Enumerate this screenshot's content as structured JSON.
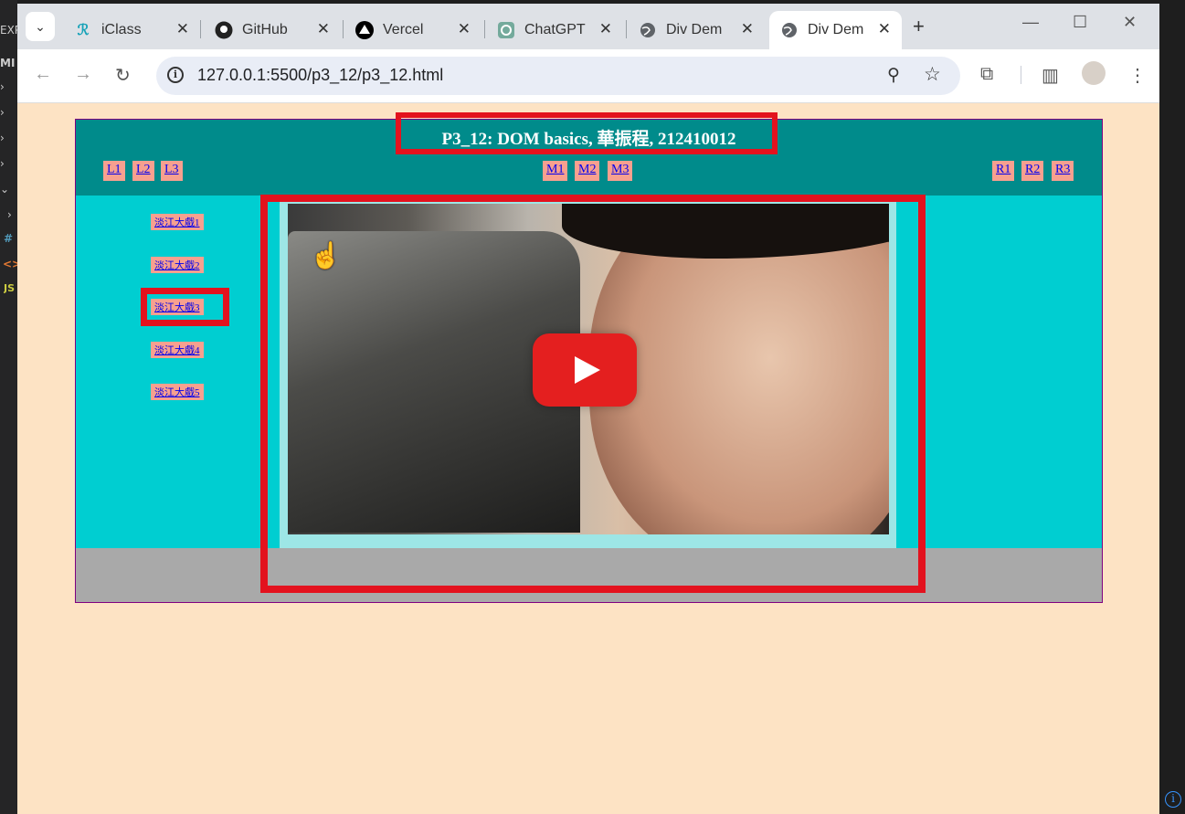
{
  "editor_strip": {
    "labels": [
      "EXP",
      "MI",
      "#",
      "<>",
      "JS"
    ]
  },
  "browser": {
    "tabs": [
      {
        "title": "iClass",
        "icon": "iclass-icon"
      },
      {
        "title": "GitHub",
        "icon": "github-icon"
      },
      {
        "title": "Vercel",
        "icon": "vercel-icon"
      },
      {
        "title": "ChatGPT",
        "icon": "chatgpt-icon"
      },
      {
        "title": "Div Demo",
        "icon": "globe-icon"
      },
      {
        "title": "Div Demo",
        "icon": "globe-icon",
        "active": true
      }
    ],
    "url": "127.0.0.1:5500/p3_12/p3_12.html"
  },
  "page": {
    "title": "P3_12: DOM basics, 華振程, 212410012",
    "left_links": [
      "L1",
      "L2",
      "L3"
    ],
    "middle_links": [
      "M1",
      "M2",
      "M3"
    ],
    "right_links": [
      "R1",
      "R2",
      "R3"
    ],
    "video_links": [
      "淡江大戲1",
      "淡江大戲2",
      "淡江大戲3",
      "淡江大戲4",
      "淡江大戲5"
    ]
  },
  "colors": {
    "page_bg": "#fde3c4",
    "header_bg": "#008b8b",
    "column_bg": "#00ced1",
    "footer_bg": "#a9a9a9",
    "link_bg": "#f7a08f",
    "highlight": "#e3121e"
  }
}
